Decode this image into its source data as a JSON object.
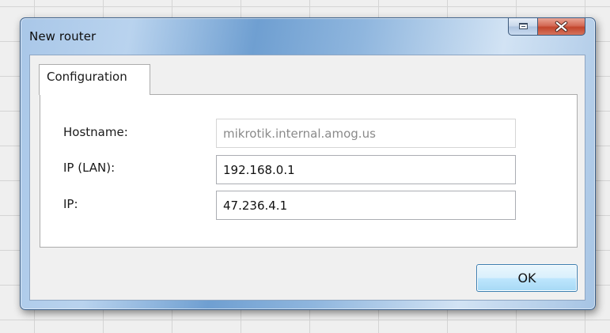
{
  "window": {
    "title": "New router"
  },
  "caption_buttons": {
    "restore_icon": "restore-icon",
    "close_icon": "close-icon"
  },
  "tabs": [
    {
      "label": "Configuration",
      "selected": true
    }
  ],
  "form": {
    "hostname": {
      "label": "Hostname:",
      "value": "mikrotik.internal.amog.us",
      "enabled": false
    },
    "ip_lan": {
      "label": "IP (LAN):",
      "value": "192.168.0.1",
      "enabled": true
    },
    "ip": {
      "label": "IP:",
      "value": "47.236.4.1",
      "enabled": true
    }
  },
  "buttons": {
    "ok_label": "OK"
  },
  "colors": {
    "close_button": "#c2452c",
    "ok_button_border": "#3c7fb1",
    "window_frame": "#6f9fd1"
  }
}
